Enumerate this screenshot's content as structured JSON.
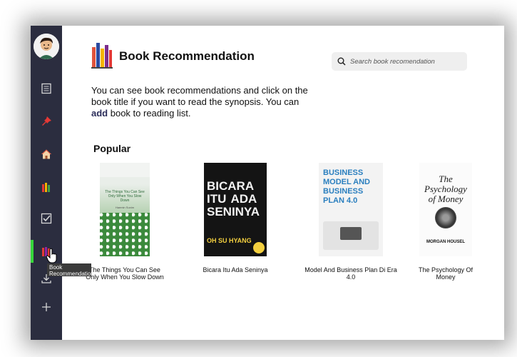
{
  "sidebar": {
    "items": [
      {
        "icon": "document-icon"
      },
      {
        "icon": "pin-icon"
      },
      {
        "icon": "home-icon"
      },
      {
        "icon": "books-stack-icon"
      },
      {
        "icon": "checklist-icon"
      },
      {
        "icon": "book-recommendation-icon",
        "active": true
      },
      {
        "icon": "download-icon"
      },
      {
        "icon": "plus-icon"
      }
    ],
    "tooltip": "Book Recommendation",
    "active_color": "#35d63a",
    "bg_color": "#2b2d3f"
  },
  "header": {
    "title": "Book Recommendation",
    "search_placeholder": "Search book recomendation"
  },
  "intro": {
    "part1": "You can see book recommendations and click on the book title if you want to read the synopsis. You can ",
    "emphasis": "add",
    "part2": " book to reading list."
  },
  "popular": {
    "heading": "Popular",
    "books": [
      {
        "title": "The Things You Can See Only When You Slow Down",
        "cover_text": "The Things You Can See Only When You Slow Down",
        "author": "Haemin Sunim"
      },
      {
        "title": "Bicara Itu Ada Seninya",
        "cover_text": "BICARA ITU ADA SENINYA",
        "author": "OH SU HYANG"
      },
      {
        "title": "Model And Business Plan Di Era 4.0",
        "cover_text": "BUSINESS MODEL AND BUSINESS PLAN 4.0"
      },
      {
        "title": "The Psychology Of Money",
        "cover_text": "The Psychology of Money",
        "author": "MORGAN HOUSEL"
      }
    ]
  }
}
